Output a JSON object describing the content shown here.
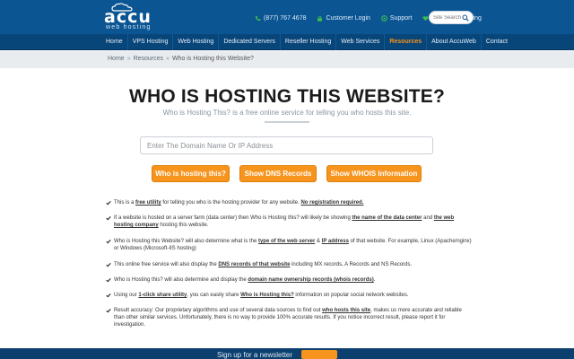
{
  "brand": {
    "name": "accu",
    "sub": "web hosting"
  },
  "top_links": [
    {
      "label": "(877) 767 4678",
      "icon": "phone-icon"
    },
    {
      "label": "Customer Login",
      "icon": "lock-icon"
    },
    {
      "label": "Support",
      "icon": "support-icon"
    },
    {
      "label": "AccuWeb Hosting",
      "icon": "heart-icon"
    }
  ],
  "top_search": {
    "placeholder": "Site Search"
  },
  "nav": [
    {
      "label": "Home"
    },
    {
      "label": "VPS Hosting"
    },
    {
      "label": "Web Hosting"
    },
    {
      "label": "Dedicated Servers"
    },
    {
      "label": "Reseller Hosting"
    },
    {
      "label": "Web Services"
    },
    {
      "label": "Resources"
    },
    {
      "label": "About AccuWeb"
    },
    {
      "label": "Contact"
    }
  ],
  "breadcrumb": {
    "home": "Home",
    "sep": "»",
    "section": "Resources",
    "current": "Who is Hosting this Website?"
  },
  "title": "WHO IS HOSTING THIS WEBSITE?",
  "subtitle": "Who is Hosting This? is a free online service for telling you who hosts this site.",
  "domain_input": {
    "placeholder": "Enter The Domain Name Or IP Address"
  },
  "buttons": {
    "who": "Who is hosting this?",
    "dns": "Show DNS Records",
    "whois": "Show WHOIS Information"
  },
  "features": [
    {
      "a": "This is a ",
      "b": "free utility",
      "c": " for telling you who is the hosting provider for any website. ",
      "d": "No registration required.",
      "e": ""
    },
    {
      "a": "If a website is hosted on a server farm (data center) then Who is Hosting this? will likely be showing ",
      "b": "the name of the data center",
      "c": " and ",
      "d": "the web hosting company",
      "e": " hosting this website."
    },
    {
      "a": "Who is Hosting this Website? will also determine what is the ",
      "b": "type of the web server",
      "c": " & ",
      "d": "IP address",
      "e": " of that website. For example, Linux (Apache/nginx) or Windows (Microsoft-IIS hosting)"
    },
    {
      "a": "This online free service will also display the ",
      "b": "DNS records of that website",
      "c": " including MX records, A Records and NS Records.",
      "d": "",
      "e": ""
    },
    {
      "a": "Who is Hosting this? will also determine and display the ",
      "b": "domain name ownership records (whois records)",
      "c": ".",
      "d": "",
      "e": ""
    },
    {
      "a": "Using our ",
      "b": "1-click share utility",
      "c": ", you can easily share ",
      "d": "Who is Hosting this?",
      "e": " information on popular social network websites."
    },
    {
      "a": "Result accuracy: Our proprietary algorithms and use of several data sources to find out ",
      "b": "who hosts this site",
      "c": ", makes us more accurate and reliable than other similar services. Unfortunately, there is no way to provide 100% accurate results. If you notice incorrect result, please report it for investigation.",
      "d": "",
      "e": ""
    }
  ],
  "footer": {
    "text": "Sign up for a newsletter"
  },
  "colors": {
    "primary": "#0b5593",
    "nav": "#084579",
    "accent": "#f7941d",
    "check": "#1a1a1a"
  }
}
